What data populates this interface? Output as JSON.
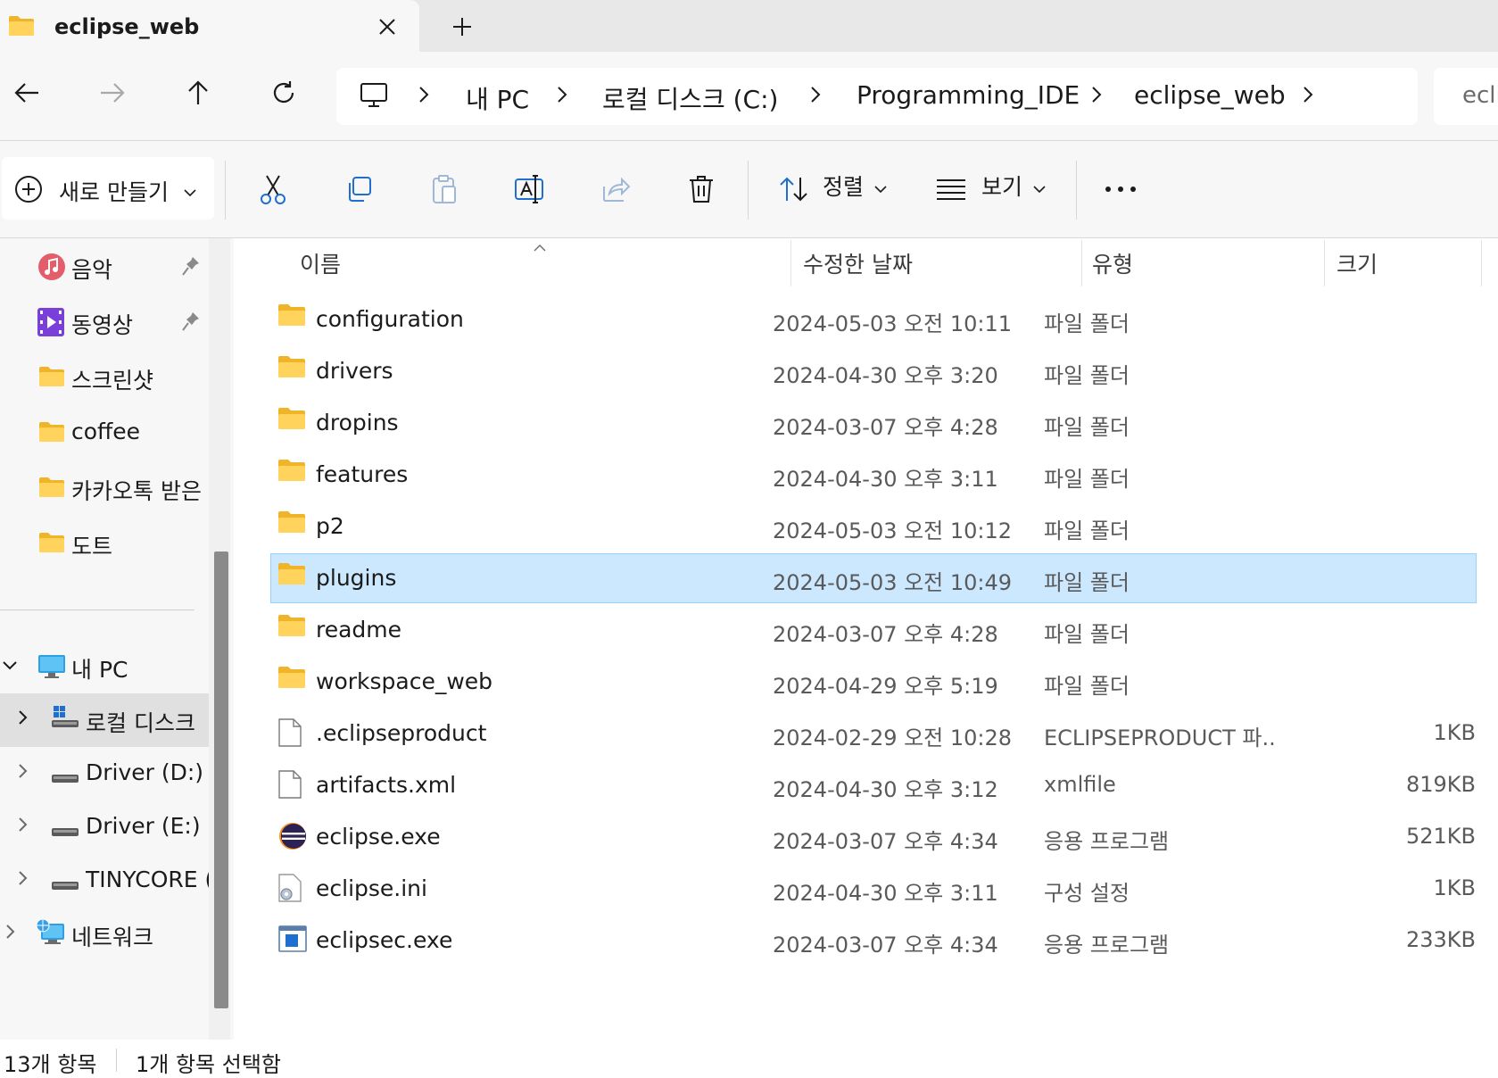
{
  "tab": {
    "title": "eclipse_web"
  },
  "breadcrumb": {
    "items": [
      "내 PC",
      "로컬 디스크 (C:)",
      "Programming_IDE",
      "eclipse_web"
    ],
    "search_text": "ecli"
  },
  "toolbar": {
    "new_label": "새로 만들기",
    "sort_label": "정렬",
    "view_label": "보기"
  },
  "sidebar": {
    "quick": [
      {
        "label": "음악",
        "icon": "music-icon"
      },
      {
        "label": "동영상",
        "icon": "video-icon"
      },
      {
        "label": "스크린샷",
        "icon": "folder-icon"
      },
      {
        "label": "coffee",
        "icon": "folder-icon"
      },
      {
        "label": "카카오톡 받은",
        "icon": "folder-icon"
      },
      {
        "label": "도트",
        "icon": "folder-icon"
      }
    ],
    "tree": [
      {
        "label": "내 PC",
        "icon": "monitor-icon"
      },
      {
        "label": "로컬 디스크",
        "icon": "windows-drive-icon"
      },
      {
        "label": "Driver (D:)",
        "icon": "drive-icon"
      },
      {
        "label": "Driver (E:)",
        "icon": "drive-icon"
      },
      {
        "label": "TINYCORE (L",
        "icon": "drive-icon"
      },
      {
        "label": "네트워크",
        "icon": "network-icon"
      }
    ]
  },
  "columns": {
    "name": "이름",
    "date": "수정한 날짜",
    "type": "유형",
    "size": "크기"
  },
  "files": [
    {
      "name": "configuration",
      "date": "2024-05-03 오전 10:11",
      "type": "파일 폴더",
      "size": "",
      "icon": "folder-icon"
    },
    {
      "name": "drivers",
      "date": "2024-04-30 오후 3:20",
      "type": "파일 폴더",
      "size": "",
      "icon": "folder-icon"
    },
    {
      "name": "dropins",
      "date": "2024-03-07 오후 4:28",
      "type": "파일 폴더",
      "size": "",
      "icon": "folder-icon"
    },
    {
      "name": "features",
      "date": "2024-04-30 오후 3:11",
      "type": "파일 폴더",
      "size": "",
      "icon": "folder-icon"
    },
    {
      "name": "p2",
      "date": "2024-05-03 오전 10:12",
      "type": "파일 폴더",
      "size": "",
      "icon": "folder-icon"
    },
    {
      "name": "plugins",
      "date": "2024-05-03 오전 10:49",
      "type": "파일 폴더",
      "size": "",
      "icon": "folder-icon"
    },
    {
      "name": "readme",
      "date": "2024-03-07 오후 4:28",
      "type": "파일 폴더",
      "size": "",
      "icon": "folder-icon"
    },
    {
      "name": "workspace_web",
      "date": "2024-04-29 오후 5:19",
      "type": "파일 폴더",
      "size": "",
      "icon": "folder-icon"
    },
    {
      "name": ".eclipseproduct",
      "date": "2024-02-29 오전 10:28",
      "type": "ECLIPSEPRODUCT 파...",
      "size": "1KB",
      "icon": "file-icon"
    },
    {
      "name": "artifacts.xml",
      "date": "2024-04-30 오후 3:12",
      "type": "xmlfile",
      "size": "819KB",
      "icon": "file-icon"
    },
    {
      "name": "eclipse.exe",
      "date": "2024-03-07 오후 4:34",
      "type": "응용 프로그램",
      "size": "521KB",
      "icon": "eclipse-app-icon"
    },
    {
      "name": "eclipse.ini",
      "date": "2024-04-30 오후 3:11",
      "type": "구성 설정",
      "size": "1KB",
      "icon": "settings-file-icon"
    },
    {
      "name": "eclipsec.exe",
      "date": "2024-03-07 오후 4:34",
      "type": "응용 프로그램",
      "size": "233KB",
      "icon": "console-app-icon"
    }
  ],
  "status": {
    "count": "13개 항목",
    "selected": "1개 항목 선택함"
  },
  "colors": {
    "selection": "#cce8ff",
    "selection_border": "#99d1ff",
    "folder": "#f8c84a",
    "chrome": "#f7f7f7"
  }
}
